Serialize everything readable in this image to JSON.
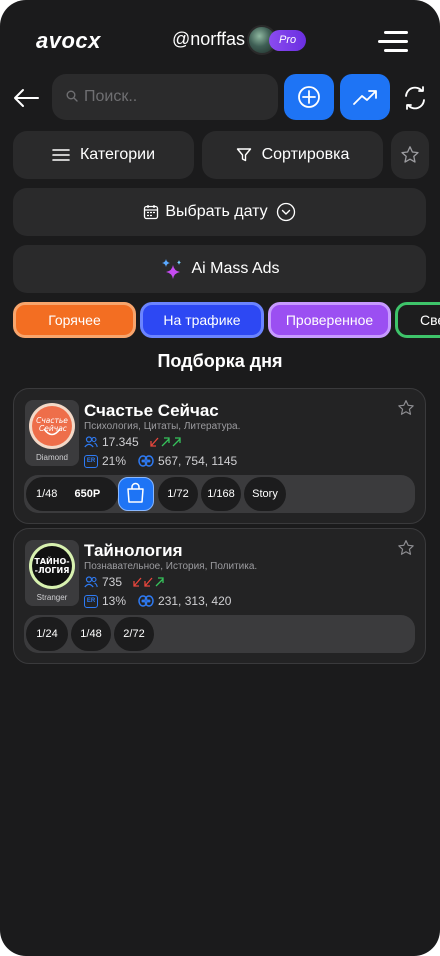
{
  "header": {
    "logo": "avocx",
    "username": "@norffas",
    "badge": "Pro"
  },
  "search": {
    "placeholder": "Поиск.."
  },
  "filters": {
    "categories": "Категории",
    "sort": "Сортировка",
    "date": "Выбрать дату",
    "ai": "Ai Mass Ads"
  },
  "chips": [
    {
      "label": "Горячее",
      "color": "#f36e22"
    },
    {
      "label": "На трафике",
      "color": "#2d48f3"
    },
    {
      "label": "Проверенное",
      "color": "#9b4ff2"
    },
    {
      "label": "Све",
      "color": "#1d1d1e"
    }
  ],
  "section_title": "Подборка дня",
  "cards": [
    {
      "title": "Счастье Сейчас",
      "tier": "Diamond",
      "categories": "Психология, Цитаты, Литература.",
      "subscribers": "17.345",
      "er": "21%",
      "views": "567, 754, 1145",
      "logo_text": "Счастье Сейчас",
      "slots": [
        "1/48",
        "650Р",
        "1/72",
        "1/168",
        "Story"
      ]
    },
    {
      "title": "Тайнология",
      "tier": "Stranger",
      "categories": "Познавательное, История, Политика.",
      "subscribers": "735",
      "er": "13%",
      "views": "231, 313, 420",
      "logo_text": "ТАЙНО--ЛОГИЯ",
      "slots": [
        "1/24",
        "1/48",
        "2/72"
      ]
    }
  ],
  "colors": {
    "accent": "#1e74f5",
    "background": "#1b1b1c",
    "panel": "#2a2a2b"
  }
}
